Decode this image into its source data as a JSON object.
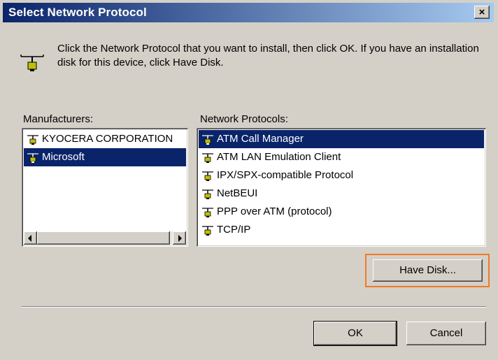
{
  "dialog": {
    "title": "Select Network Protocol",
    "close_label": "×",
    "instruction": "Click the Network Protocol that you want to install, then click OK. If you have an installation disk for this device, click Have Disk."
  },
  "manufacturers": {
    "label": "Manufacturers:",
    "items": [
      {
        "label": "KYOCERA CORPORATION",
        "selected": false
      },
      {
        "label": "Microsoft",
        "selected": true
      }
    ]
  },
  "protocols": {
    "label": "Network Protocols:",
    "items": [
      {
        "label": "ATM Call Manager",
        "selected": true
      },
      {
        "label": "ATM LAN Emulation Client",
        "selected": false
      },
      {
        "label": "IPX/SPX-compatible Protocol",
        "selected": false
      },
      {
        "label": "NetBEUI",
        "selected": false
      },
      {
        "label": "PPP over ATM (protocol)",
        "selected": false
      },
      {
        "label": "TCP/IP",
        "selected": false
      }
    ]
  },
  "buttons": {
    "have_disk": "Have Disk...",
    "ok": "OK",
    "cancel": "Cancel"
  },
  "colors": {
    "selection": "#0a246a",
    "highlight_box": "#f07a23",
    "face": "#d4d0c8"
  },
  "icons": {
    "header": "network-protocol-icon",
    "item": "network-protocol-icon"
  }
}
